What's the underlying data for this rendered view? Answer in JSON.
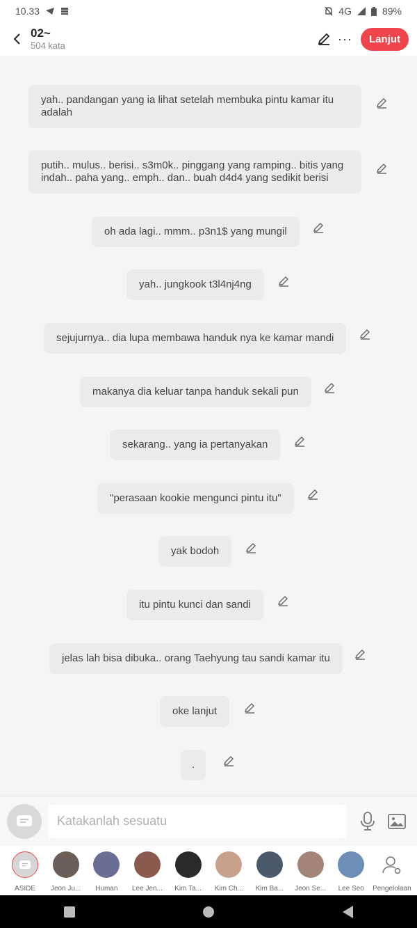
{
  "status_bar": {
    "time": "10.33",
    "network": "4G",
    "battery": "89%"
  },
  "header": {
    "title": "02~",
    "subtitle": "504 kata",
    "next_label": "Lanjut",
    "more_label": "···"
  },
  "messages": [
    {
      "text": "yah.. pandangan yang ia lihat setelah membuka pintu kamar itu adalah"
    },
    {
      "text": "putih.. mulus.. berisi.. s3m0k.. pinggang yang ramping.. bitis yang indah.. paha yang.. emph.. dan.. buah d4d4 yang sedikit berisi"
    },
    {
      "text": "oh ada lagi.. mmm.. p3n1$ yang mungil"
    },
    {
      "text": "yah.. jungkook t3l4nj4ng"
    },
    {
      "text": "sejujurnya.. dia lupa membawa handuk nya ke kamar mandi"
    },
    {
      "text": "makanya dia keluar tanpa handuk sekali pun"
    },
    {
      "text": "sekarang.. yang ia pertanyakan"
    },
    {
      "text": "\"perasaan kookie mengunci pintu itu\""
    },
    {
      "text": "yak bodoh"
    },
    {
      "text": "itu pintu kunci dan sandi"
    },
    {
      "text": "jelas lah bisa dibuka.. orang Taehyung tau sandi kamar itu"
    },
    {
      "text": "oke lanjut"
    },
    {
      "text": "."
    }
  ],
  "composer": {
    "placeholder": "Katakanlah sesuatu"
  },
  "characters": [
    {
      "name": "ASIDE",
      "color": "#d6d6d6"
    },
    {
      "name": "Jeon Ju...",
      "color": "#6b5d58"
    },
    {
      "name": "Human",
      "color": "#6a6e94"
    },
    {
      "name": "Lee Jen...",
      "color": "#8a5a4e"
    },
    {
      "name": "Kim Ta...",
      "color": "#2a2a2a"
    },
    {
      "name": "Kim Ch...",
      "color": "#c9a08a"
    },
    {
      "name": "Kim Ba...",
      "color": "#4b5a6b"
    },
    {
      "name": "Jeon Se...",
      "color": "#a38478"
    },
    {
      "name": "Lee Seo",
      "color": "#6d8fb5"
    },
    {
      "name": "Pengelolaan",
      "color": "#ffffff"
    }
  ],
  "colors": {
    "accent": "#f0464b",
    "bubble": "#ebebeb",
    "background": "#f5f5f5"
  }
}
